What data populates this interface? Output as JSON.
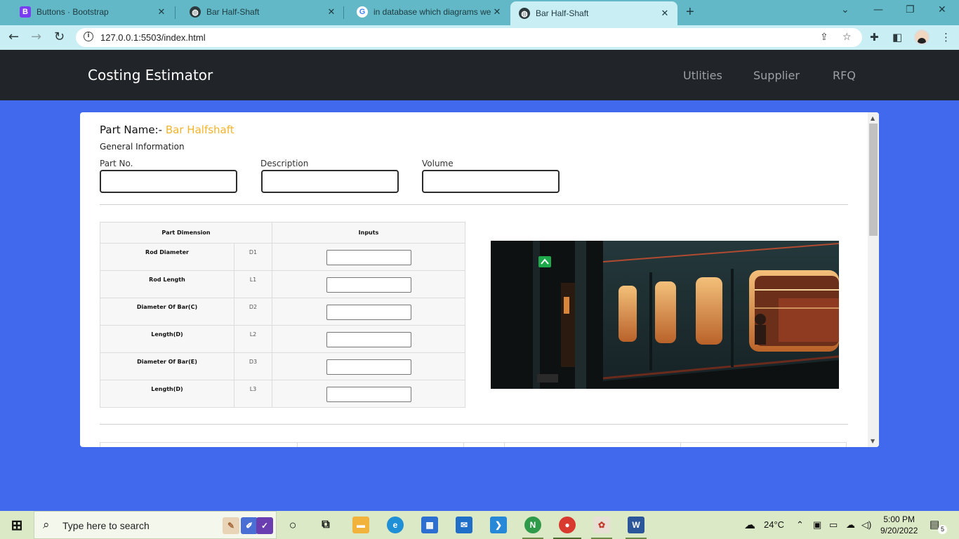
{
  "browser": {
    "tabs": [
      {
        "title": "Buttons · Bootstrap",
        "favicon": "bootstrap-icon",
        "active": false
      },
      {
        "title": "Bar Half-Shaft",
        "favicon": "globe-icon",
        "active": false
      },
      {
        "title": "in database which diagrams we w",
        "favicon": "google-icon",
        "active": false
      },
      {
        "title": "Bar Half-Shaft",
        "favicon": "globe-icon",
        "active": true
      }
    ],
    "url": "127.0.0.1:5503/index.html"
  },
  "navbar": {
    "brand": "Costing Estimator",
    "links": [
      "Utlities",
      "Supplier",
      "RFQ"
    ]
  },
  "form": {
    "part_name_label": "Part Name:-",
    "part_name_value": "Bar Halfshaft",
    "section_title": "General Information",
    "fields": [
      {
        "label": "Part No.",
        "value": ""
      },
      {
        "label": "Description",
        "value": ""
      },
      {
        "label": "Volume",
        "value": ""
      }
    ]
  },
  "dimension_table": {
    "headers": [
      "Part Dimension",
      "Inputs"
    ],
    "rows": [
      {
        "name": "Rod Diameter",
        "code": "D1",
        "value": ""
      },
      {
        "name": "Rod Length",
        "code": "L1",
        "value": ""
      },
      {
        "name": "Diameter Of Bar(C)",
        "code": "D2",
        "value": ""
      },
      {
        "name": "Length(D)",
        "code": "L2",
        "value": ""
      },
      {
        "name": "Diameter Of Bar(E)",
        "code": "D3",
        "value": ""
      },
      {
        "name": "Length(D)",
        "code": "L3",
        "value": ""
      }
    ]
  },
  "image": {
    "subject": "subway train at night"
  },
  "taskbar": {
    "search_placeholder": "Type here to search",
    "weather": "24°C",
    "time": "5:00 PM",
    "date": "9/20/2022",
    "notification_count": "5"
  },
  "colors": {
    "page_bg": "#4169ee",
    "navbar_bg": "#212529",
    "accent": "#f4b32a",
    "tabstrip": "#62b8c6",
    "taskbar": "#dbe9c6"
  }
}
